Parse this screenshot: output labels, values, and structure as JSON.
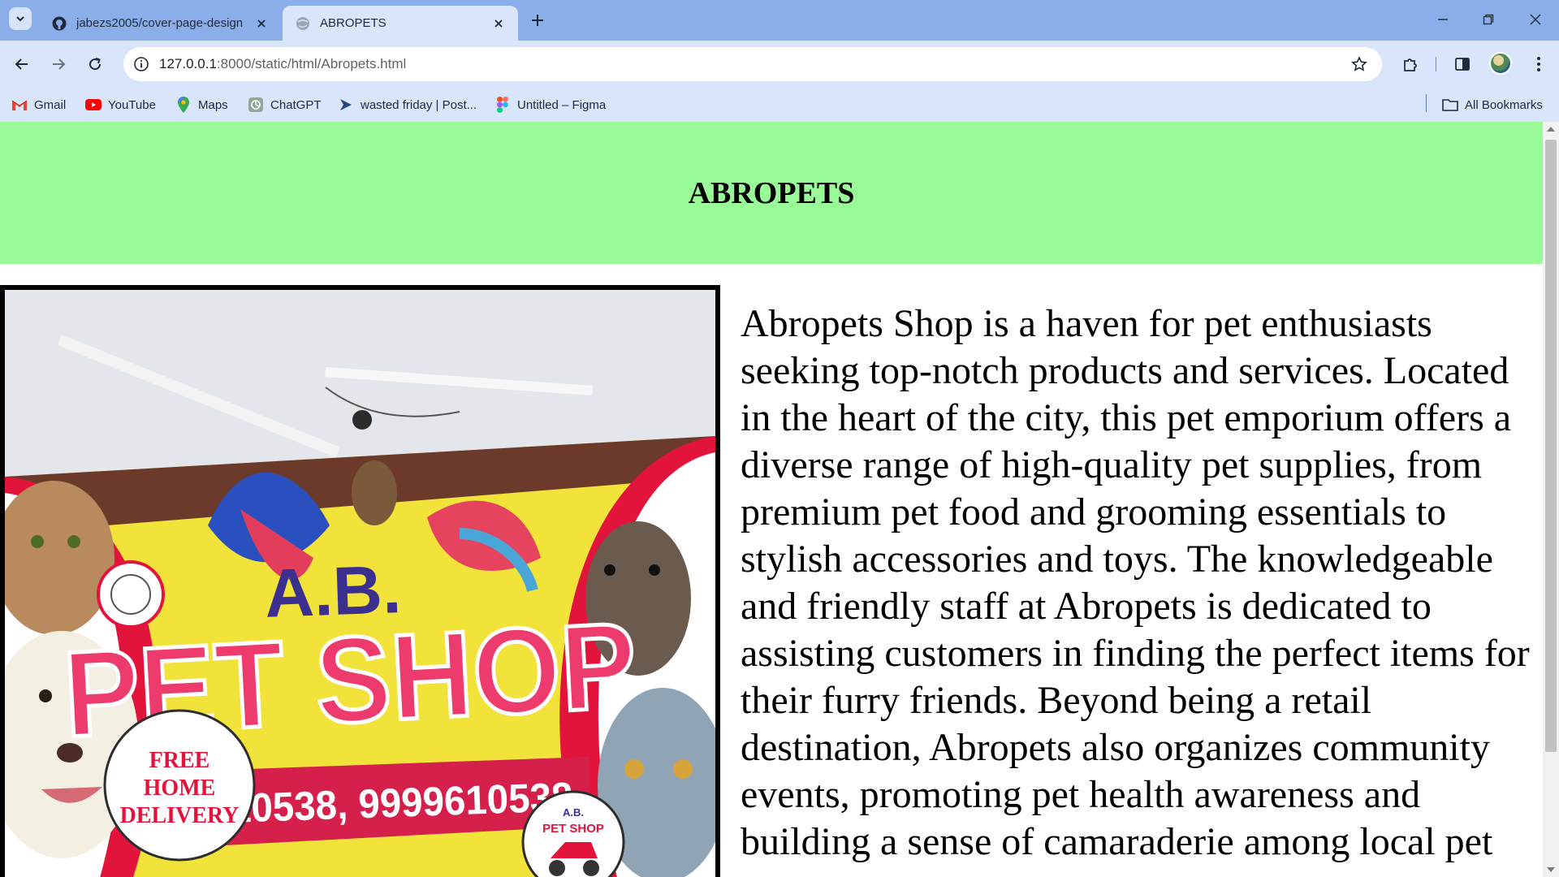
{
  "browser": {
    "tabs": [
      {
        "title": "jabezs2005/cover-page-design",
        "icon": "github-icon"
      },
      {
        "title": "ABROPETS",
        "icon": "globe-icon"
      }
    ],
    "url_host": "127.0.0.1",
    "url_path": ":8000/static/html/Abropets.html",
    "bookmarks": [
      {
        "label": "Gmail",
        "icon": "gmail-icon"
      },
      {
        "label": "YouTube",
        "icon": "youtube-icon"
      },
      {
        "label": "Maps",
        "icon": "maps-icon"
      },
      {
        "label": "ChatGPT",
        "icon": "chatgpt-icon"
      },
      {
        "label": "wasted friday | Post...",
        "icon": "postman-icon"
      },
      {
        "label": "Untitled – Figma",
        "icon": "figma-icon"
      }
    ],
    "all_bookmarks_label": "All Bookmarks",
    "colors": {
      "tabstrip": "#8aaeea",
      "toolbar": "#d8e5fb"
    }
  },
  "page": {
    "heading": "ABROPETS",
    "description": "Abropets Shop is a haven for pet enthusiasts seeking top-notch products and services. Located in the heart of the city, this pet emporium offers a diverse range of high-quality pet supplies, from premium pet food and grooming essentials to stylish accessories and toys. The knowledgeable and friendly staff at Abropets is dedicated to assisting customers in finding the perfect items for their furry friends. Beyond being a retail destination, Abropets also organizes community events, promoting pet health awareness and building a sense of camaraderie among local pet",
    "colors": {
      "header_bg": "#98fb98"
    },
    "shop_sign": {
      "line1": "A.B.",
      "line2": "PET SHOP",
      "delivery": [
        "FREE",
        "HOME",
        "DELIVERY"
      ],
      "phones": "9971610538, 9999610538",
      "badge_top": "A.B.",
      "badge_bottom": "PET SHOP"
    }
  }
}
